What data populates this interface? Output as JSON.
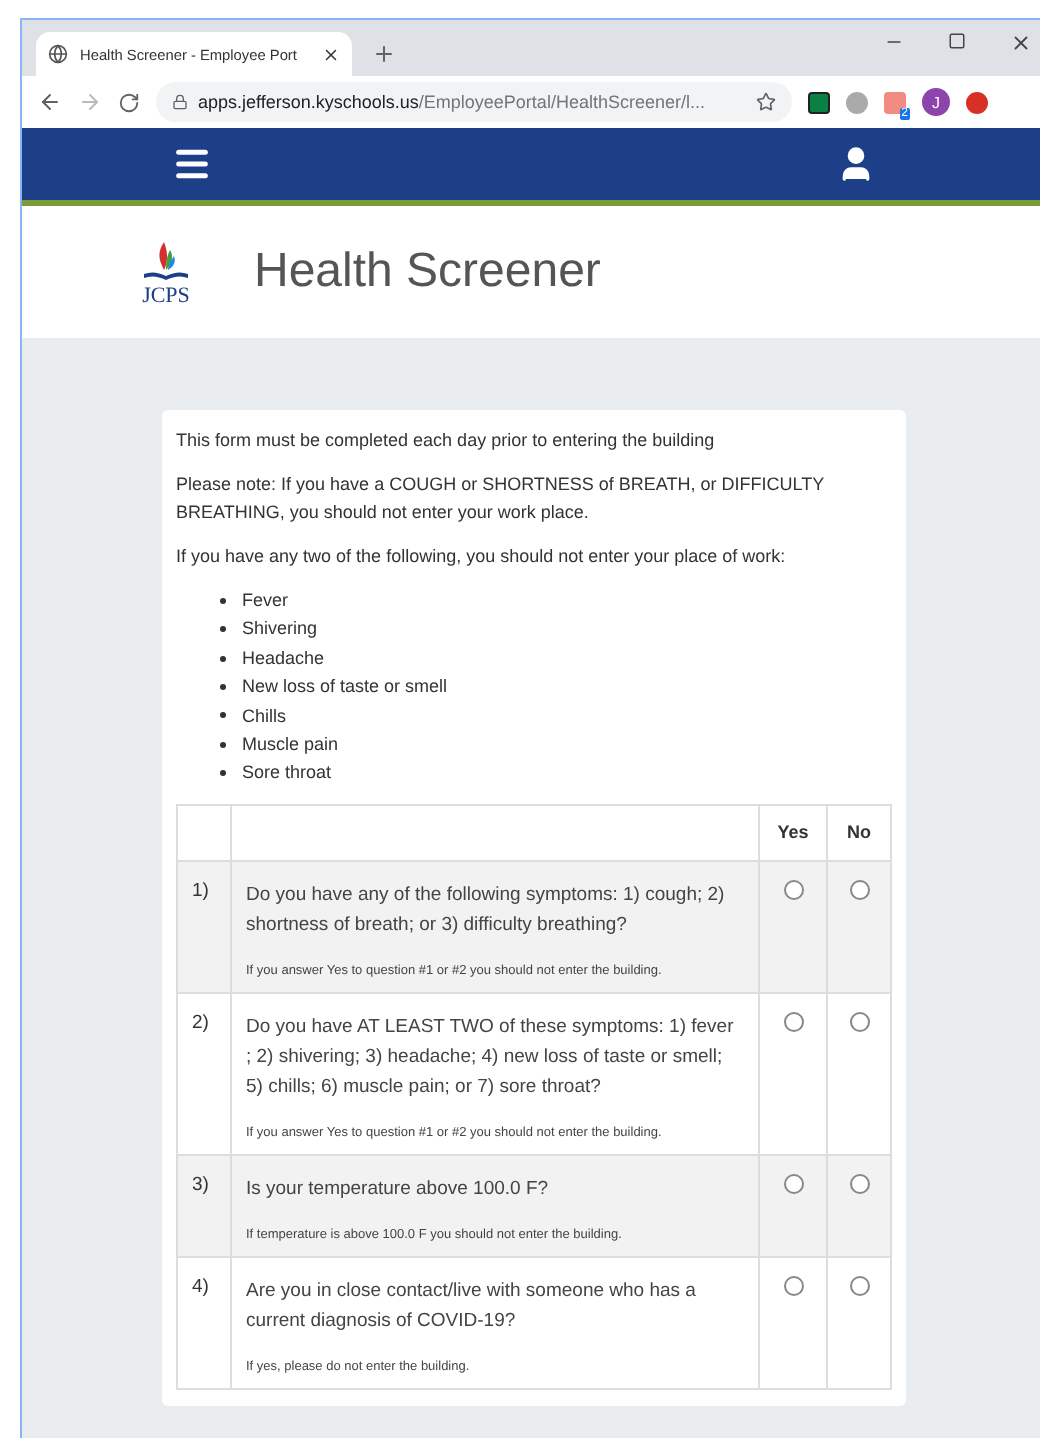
{
  "browser": {
    "tab_title": "Health Screener - Employee Port",
    "url_host": "apps.jefferson.kyschools.us",
    "url_path": "/EmployeePortal/HealthScreener/l...",
    "profile_initial": "J",
    "extension_badge": "2"
  },
  "header": {
    "logo_text": "JCPS",
    "title": "Health Screener"
  },
  "form": {
    "intro": "This form must be completed each day prior to entering the building",
    "note": "Please note: If you have a COUGH or SHORTNESS of BREATH, or DIFFICULTY BREATHING, you should not enter your work place.",
    "list_intro": "If you have any two of the following, you should not enter your place of work:",
    "symptoms": [
      "Fever",
      "Shivering",
      "Headache",
      "New loss of taste or smell",
      "Chills",
      "Muscle pain",
      "Sore throat"
    ],
    "columns": [
      "Yes",
      "No"
    ],
    "questions": [
      {
        "number": "1)",
        "text": "Do you have any of the following symptoms: 1) cough; 2) shortness of breath; or 3) difficulty breathing?",
        "note": "If you answer Yes to question #1 or #2 you should not enter the building.",
        "answers": [
          {
            "selected": false
          },
          {
            "selected": false
          }
        ]
      },
      {
        "number": "2)",
        "text": "Do you have AT LEAST TWO of these symptoms: 1) fever ; 2) shivering; 3) headache; 4) new loss of taste or smell; 5) chills; 6) muscle pain; or 7) sore throat?",
        "note": "If you answer Yes to question #1 or #2 you should not enter the building.",
        "answers": [
          {
            "selected": false
          },
          {
            "selected": false
          }
        ]
      },
      {
        "number": "3)",
        "text": "Is your temperature above 100.0 F?",
        "note": "If temperature is above 100.0 F you should not enter the building.",
        "answers": [
          {
            "selected": false
          },
          {
            "selected": false
          }
        ]
      },
      {
        "number": "4)",
        "text": "Are you in close contact/live with someone who has a current diagnosis of COVID-19?",
        "note": "If yes, please do not enter the building.",
        "answers": [
          {
            "selected": false
          },
          {
            "selected": false
          }
        ]
      }
    ]
  }
}
